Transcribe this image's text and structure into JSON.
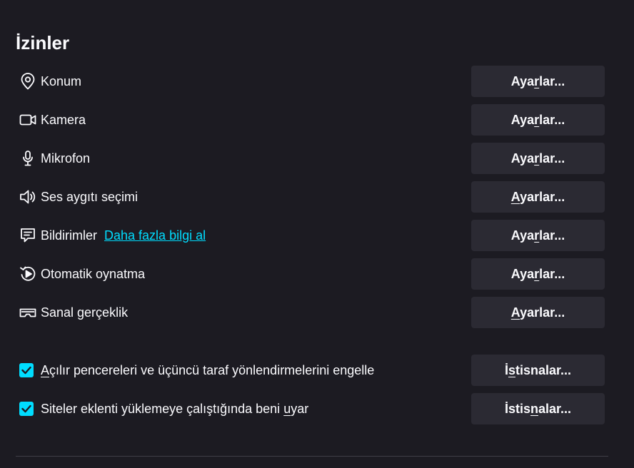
{
  "section": {
    "title": "İzinler"
  },
  "permissions": [
    {
      "id": "location",
      "icon": "location-pin-icon",
      "label": "Konum",
      "button": {
        "before": "Aya",
        "accesskey": "r",
        "after": "lar..."
      }
    },
    {
      "id": "camera",
      "icon": "camera-icon",
      "label": "Kamera",
      "button": {
        "before": "Aya",
        "accesskey": "r",
        "after": "lar..."
      }
    },
    {
      "id": "microphone",
      "icon": "microphone-icon",
      "label": "Mikrofon",
      "button": {
        "before": "Aya",
        "accesskey": "r",
        "after": "lar..."
      }
    },
    {
      "id": "speaker",
      "icon": "speaker-icon",
      "label": "Ses aygıtı seçimi",
      "button": {
        "before": "",
        "accesskey": "A",
        "after": "yarlar..."
      }
    },
    {
      "id": "notifications",
      "icon": "notification-message-icon",
      "label": "Bildirimler",
      "link": "Daha fazla bilgi al",
      "button": {
        "before": "Aya",
        "accesskey": "r",
        "after": "lar..."
      }
    },
    {
      "id": "autoplay",
      "icon": "autoplay-icon",
      "label": "Otomatik oynatma",
      "button": {
        "before": "Aya",
        "accesskey": "r",
        "after": "lar..."
      }
    },
    {
      "id": "vr",
      "icon": "vr-headset-icon",
      "label": "Sanal gerçeklik",
      "button": {
        "before": "",
        "accesskey": "A",
        "after": "yarlar..."
      }
    }
  ],
  "checkboxes": [
    {
      "id": "block-popups",
      "checked": true,
      "label": {
        "before": "",
        "accesskey": "A",
        "after": "çılır pencereleri ve üçüncü taraf yönlendirmelerini engelle"
      },
      "button": {
        "before": "İ",
        "accesskey": "s",
        "after": "tisnalar..."
      }
    },
    {
      "id": "warn-addon-install",
      "checked": true,
      "label": {
        "before": "Siteler eklenti yüklemeye çalıştığında beni ",
        "accesskey": "u",
        "after": "yar"
      },
      "button": {
        "before": "İstis",
        "accesskey": "n",
        "after": "alar..."
      }
    }
  ],
  "colors": {
    "background": "#1c1b22",
    "button": "#2b2a33",
    "accent": "#00ddff",
    "text": "#fbfbfe"
  }
}
